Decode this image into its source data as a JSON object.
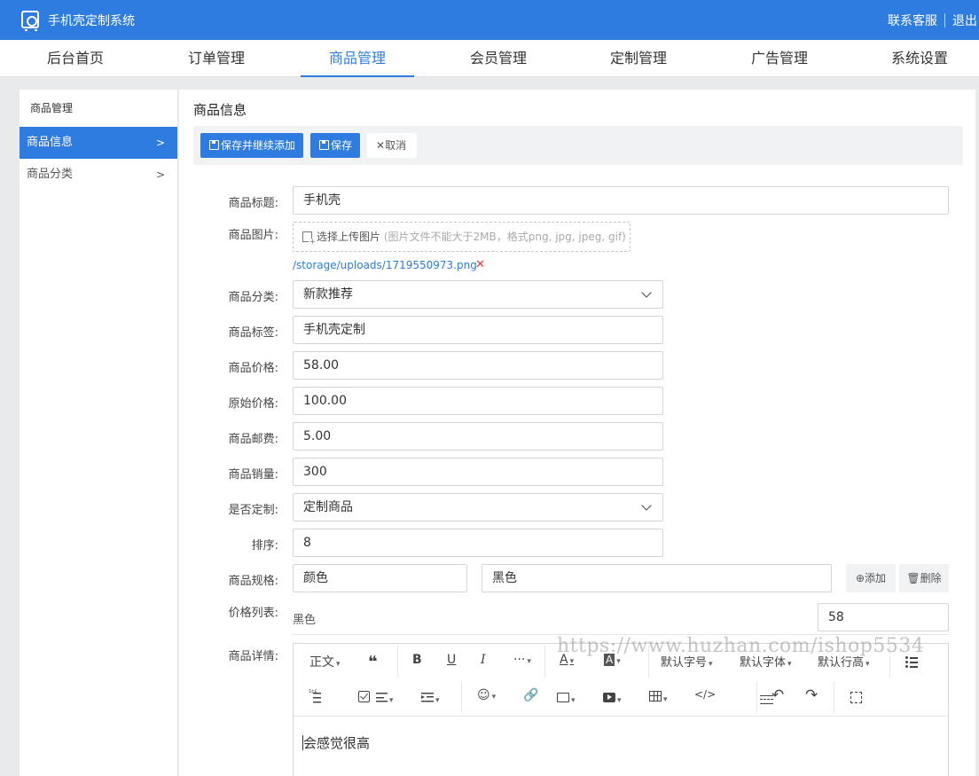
{
  "app": {
    "title": "手机壳定制系统",
    "customer_service": "联系客服",
    "logout": "退出"
  },
  "nav": [
    "后台首页",
    "订单管理",
    "商品管理",
    "会员管理",
    "定制管理",
    "广告管理",
    "系统设置"
  ],
  "nav_active": "商品管理",
  "sidebar": {
    "title": "商品管理",
    "items": [
      {
        "label": "商品信息",
        "active": true
      },
      {
        "label": "商品分类",
        "active": false
      }
    ]
  },
  "page_title": "商品信息",
  "toolbar": {
    "save_continue": "保存并继续添加",
    "save": "保存",
    "cancel": "取消"
  },
  "form": {
    "title": {
      "label": "商品标题:",
      "value": "手机壳"
    },
    "image": {
      "label": "商品图片:",
      "upload_text": "选择上传图片",
      "upload_hint": "(图片文件不能大于2MB，格式png, jpg, jpeg, gif)",
      "file_path": "/storage/uploads/1719550973.png",
      "remove": "✕"
    },
    "category": {
      "label": "商品分类:",
      "value": "新款推荐"
    },
    "tags": {
      "label": "商品标签:",
      "value": "手机壳定制"
    },
    "price": {
      "label": "商品价格:",
      "value": "58.00"
    },
    "original_price": {
      "label": "原始价格:",
      "value": "100.00"
    },
    "shipping": {
      "label": "商品邮费:",
      "value": "5.00"
    },
    "sales": {
      "label": "商品销量:",
      "value": "300"
    },
    "customizable": {
      "label": "是否定制:",
      "value": "定制商品"
    },
    "sort": {
      "label": "排序:",
      "value": "8"
    },
    "spec": {
      "label": "商品规格:",
      "name": "颜色",
      "value": "黑色",
      "add": "添加",
      "delete": "删除"
    },
    "price_list": {
      "label": "价格列表:",
      "item": "黑色",
      "value": "58"
    },
    "detail": {
      "label": "商品详情:",
      "toolbar": {
        "paragraph": "正文",
        "font_size": "默认字号",
        "font_family": "默认字体",
        "line_height": "默认行高"
      },
      "content": "会感觉很高"
    }
  },
  "watermark": "https://www.huzhan.com/ishop5534",
  "colors": {
    "primary": "#2e7ce0",
    "danger": "#e5393b",
    "toolbar_bg": "#f1f2f4"
  }
}
